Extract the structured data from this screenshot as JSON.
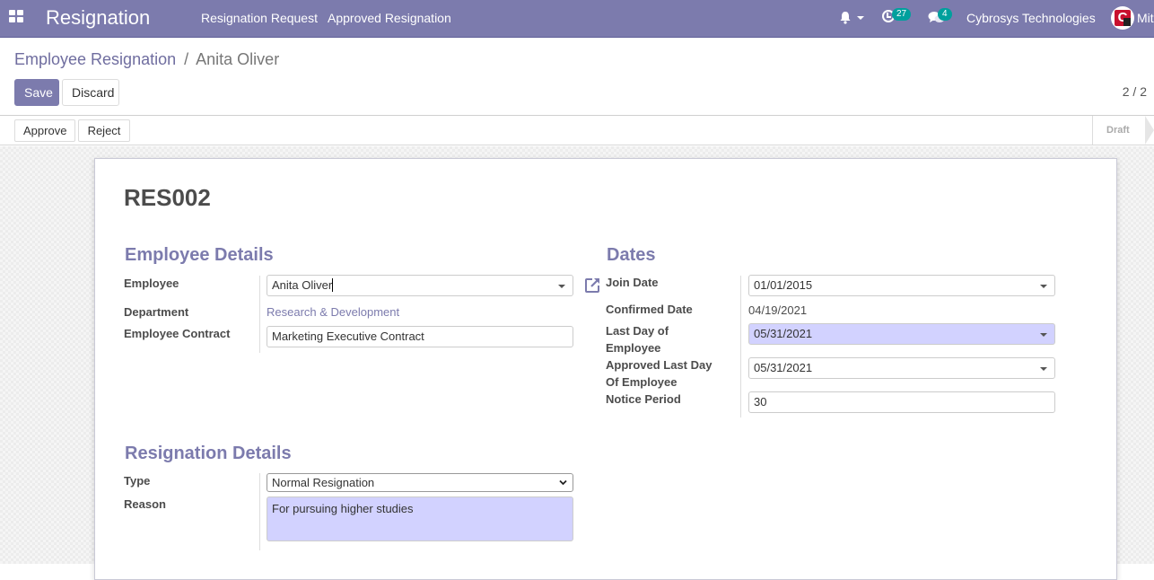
{
  "navbar": {
    "app_title": "Resignation",
    "menu": [
      "Resignation Request",
      "Approved Resignation"
    ],
    "activity_count": "27",
    "message_count": "4",
    "company": "Cybrosys Technologies",
    "user_name": "Mitc",
    "brand_color": "#7c7bad",
    "badge_color": "#00a09d"
  },
  "control_panel": {
    "breadcrumb_parent": "Employee Resignation",
    "breadcrumb_separator": "/",
    "breadcrumb_current": "Anita Oliver",
    "save_label": "Save",
    "discard_label": "Discard",
    "pager": "2 / 2"
  },
  "statusbar": {
    "approve_label": "Approve",
    "reject_label": "Reject",
    "stage": "Draft"
  },
  "form": {
    "reference": "RES002",
    "employee_details": {
      "title": "Employee Details",
      "employee_label": "Employee",
      "employee_value": "Anita Oliver",
      "department_label": "Department",
      "department_value": "Research & Development",
      "contract_label": "Employee Contract",
      "contract_value": "Marketing Executive Contract"
    },
    "dates": {
      "title": "Dates",
      "join_date_label": "Join Date",
      "join_date_value": "01/01/2015",
      "confirmed_date_label": "Confirmed Date",
      "confirmed_date_value": "04/19/2021",
      "last_day_label_1": "Last Day of",
      "last_day_label_2": "Employee",
      "last_day_value": "05/31/2021",
      "approved_last_day_label_1": "Approved Last Day",
      "approved_last_day_label_2": "Of Employee",
      "approved_last_day_value": "05/31/2021",
      "notice_period_label": "Notice Period",
      "notice_period_value": "30"
    },
    "resignation_details": {
      "title": "Resignation Details",
      "type_label": "Type",
      "type_value": "Normal Resignation",
      "reason_label": "Reason",
      "reason_value": "For pursuing higher studies"
    }
  }
}
